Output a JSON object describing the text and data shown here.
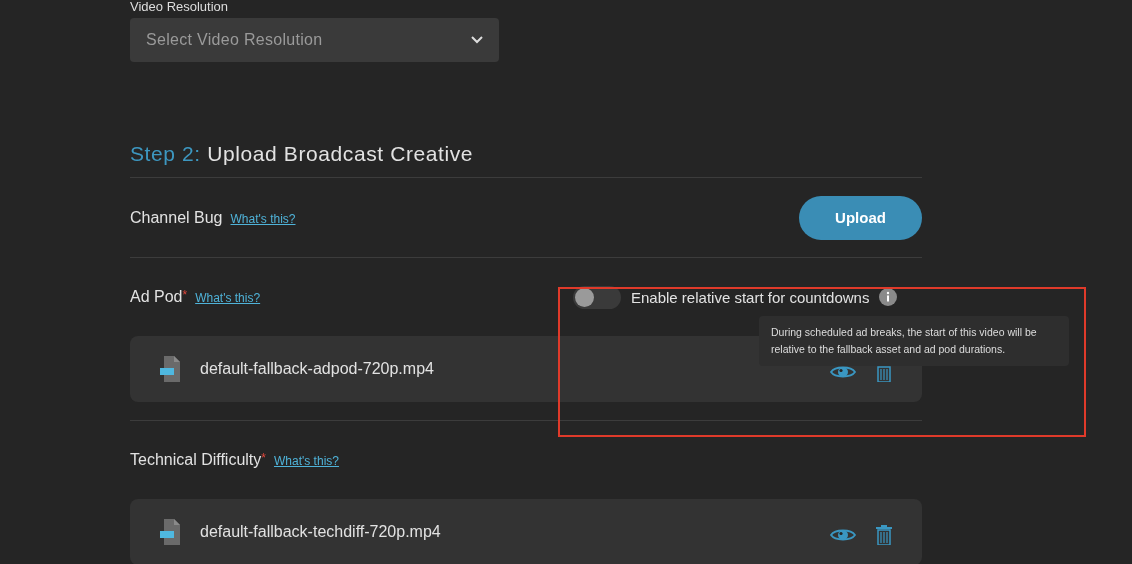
{
  "video_resolution": {
    "label": "Video Resolution",
    "placeholder": "Select Video Resolution"
  },
  "step": {
    "number": "Step 2:",
    "title": "Upload Broadcast Creative"
  },
  "assets": [
    {
      "kind": "upload",
      "label": "Channel Bug",
      "help_link": "What's this?",
      "button": "Upload"
    },
    {
      "kind": "file",
      "label": "Ad Pod",
      "required_mark": "*",
      "help_link": "What's this?",
      "toggle": {
        "label": "Enable relative start for countdowns",
        "on": false,
        "tooltip": "During scheduled ad breaks, the start of this video will be relative to the fallback asset and ad pod durations."
      },
      "file": "default-fallback-adpod-720p.mp4"
    },
    {
      "kind": "file",
      "label": "Technical Difficulty",
      "required_mark": "*",
      "help_link": "What's this?",
      "file": "default-fallback-techdiff-720p.mp4"
    }
  ]
}
